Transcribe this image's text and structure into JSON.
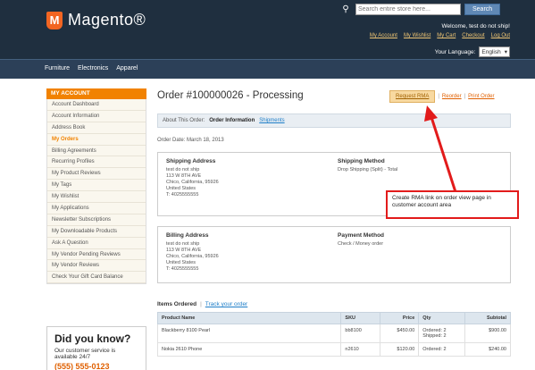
{
  "header": {
    "logo_mark": "M",
    "logo_text": "Magento®",
    "search_placeholder": "Search entire store here...",
    "search_button": "Search",
    "welcome": "Welcome, test do not ship!",
    "links": [
      "My Account",
      "My Wishlist",
      "My Cart",
      "Checkout",
      "Log Out"
    ],
    "language_label": "Your Language:",
    "language_value": "English"
  },
  "nav": {
    "items": [
      "Furniture",
      "Electronics",
      "Apparel"
    ]
  },
  "sidebar": {
    "title": "MY ACCOUNT",
    "items": [
      "Account Dashboard",
      "Account Information",
      "Address Book",
      "My Orders",
      "Billing Agreements",
      "Recurring Profiles",
      "My Product Reviews",
      "My Tags",
      "My Wishlist",
      "My Applications",
      "Newsletter Subscriptions",
      "My Downloadable Products",
      "Ask A Question",
      "My Vendor Pending Reviews",
      "My Vendor Reviews",
      "Check Your Gift Card Balance"
    ]
  },
  "did_you_know": {
    "title": "Did you know?",
    "text": "Our customer service is available 24/7",
    "phone": "(555) 555-0123"
  },
  "order": {
    "title": "Order #100000026 - Processing",
    "rma_button": "Request RMA",
    "reorder": "Reorder",
    "sep": "|",
    "print": "Print Order",
    "tabs_label": "About This Order:",
    "tab_info": "Order Information",
    "tab_shipments": "Shipments",
    "date": "Order Date: March 18, 2013",
    "shipping_address": {
      "heading": "Shipping Address",
      "lines": [
        "test do not ship",
        "113 W 8TH AVE",
        "Chico, California, 95926",
        "United States",
        "T: 4025555555"
      ]
    },
    "shipping_method": {
      "heading": "Shipping Method",
      "lines": [
        "Drop Shipping (Split) - Total"
      ]
    },
    "billing_address": {
      "heading": "Billing Address",
      "lines": [
        "test do not ship",
        "113 W 8TH AVE",
        "Chico, California, 95926",
        "United States",
        "T: 4025555555"
      ]
    },
    "payment_method": {
      "heading": "Payment Method",
      "lines": [
        "Check / Money order"
      ]
    },
    "items_heading": "Items Ordered",
    "items_sep": "|",
    "track_link": "Track your order",
    "columns": [
      "Product Name",
      "SKU",
      "Price",
      "Qty",
      "Subtotal"
    ],
    "rows": [
      {
        "name": "Blackberry 8100 Pearl",
        "sku": "bb8100",
        "price": "$450.00",
        "qty": [
          "Ordered: 2",
          "Shipped: 2"
        ],
        "subtotal": "$900.00"
      },
      {
        "name": "Nokia 2610 Phone",
        "sku": "n2610",
        "price": "$120.00",
        "qty": [
          "Ordered: 2"
        ],
        "subtotal": "$240.00"
      }
    ]
  },
  "callout": {
    "text": "Create RMA link on order view page in customer account area"
  },
  "colors": {
    "header_bg": "#1f2f3f",
    "accent": "#f18200",
    "link": "#1e7ec8",
    "callout_border": "#e21b1b"
  }
}
